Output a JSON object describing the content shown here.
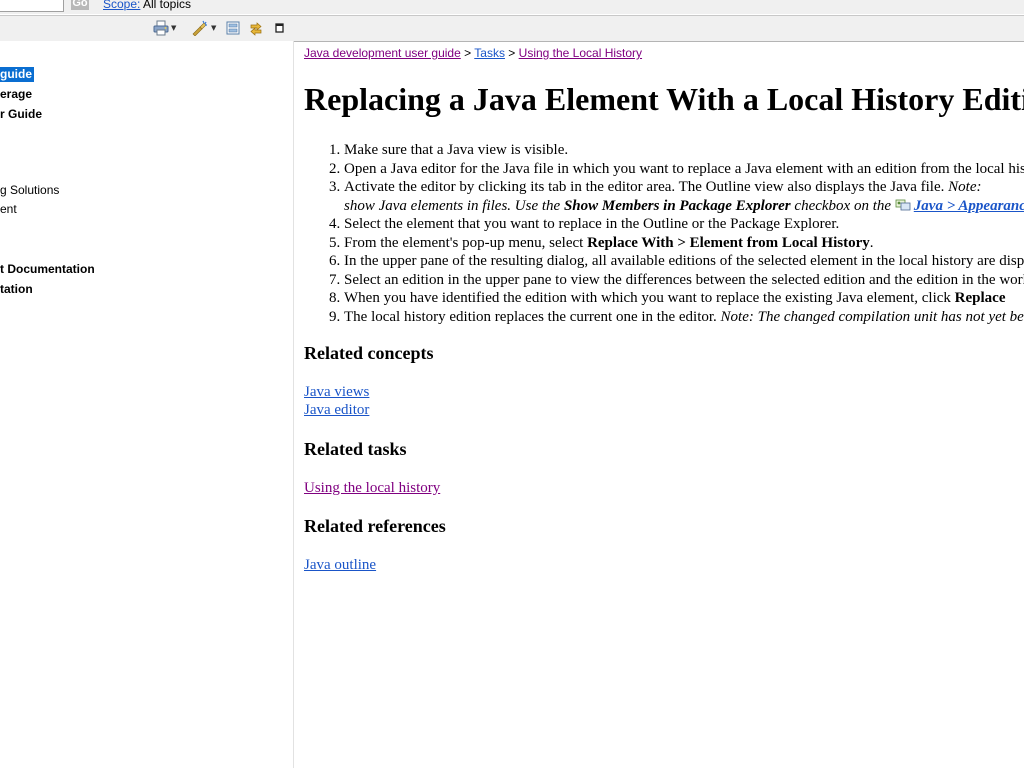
{
  "search": {
    "go_label": "Go",
    "scope_label": "Scope:",
    "scope_value": "All topics"
  },
  "nav": {
    "items": [
      {
        "label": "guide",
        "bold": true,
        "selected": true
      },
      {
        "label": "erage",
        "bold": true,
        "selected": false
      },
      {
        "label": "r Guide",
        "bold": true,
        "selected": false
      },
      {
        "label": "g Solutions",
        "bold": false,
        "selected": false
      },
      {
        "label": "ent",
        "bold": false,
        "selected": false
      },
      {
        "label": "t Documentation",
        "bold": true,
        "selected": false
      },
      {
        "label": "tation",
        "bold": true,
        "selected": false
      }
    ]
  },
  "breadcrumb": {
    "item1": "Java development user guide",
    "sep": ">",
    "item2": "Tasks",
    "item3": "Using the Local History"
  },
  "title": "Replacing a Java Element With a Local History Edition",
  "steps": {
    "s1": "Make sure that a Java view is visible.",
    "s2": "Open a Java editor for the Java file in which you want to replace a Java element with an edition from the local history.",
    "s3a": "Activate the editor by clicking its tab in the editor area. The Outline view also displays the Java file. ",
    "s3_note": "Note:",
    "s3b_pre": "show Java elements in files. Use the ",
    "s3b_bold": "Show Members in Package Explorer",
    "s3b_mid": " checkbox on the ",
    "s3b_link": "Java > Appearance",
    "s4": "Select the element that you want to replace in the Outline or the Package Explorer.",
    "s5_pre": "From the element's pop-up menu, select ",
    "s5_bold": "Replace With > Element from Local History",
    "s5_post": ".",
    "s6": "In the upper pane of the resulting dialog, all available editions of the selected element in the local history are displayed.",
    "s7": "Select an edition in the upper pane to view the differences between the selected edition and the edition in the workbench.",
    "s8_pre": "When you have identified the edition with which you want to replace the existing Java element, click ",
    "s8_bold": "Replace",
    "s9_pre": "The local history edition replaces the current one in the editor. ",
    "s9_note": "Note: The changed compilation unit has not yet been saved."
  },
  "related": {
    "concepts_heading": "Related concepts",
    "concepts": [
      "Java views",
      "Java editor"
    ],
    "tasks_heading": "Related tasks",
    "tasks": [
      "Using the local history"
    ],
    "references_heading": "Related references",
    "references": [
      "Java outline"
    ]
  },
  "colors": {
    "link": "#1a55c8",
    "visited": "#800080",
    "selection": "#0a6ed1"
  },
  "icons": [
    "print-icon",
    "highlight-icon",
    "collapse-all-icon",
    "link-with-contents-icon",
    "maximize-icon"
  ]
}
